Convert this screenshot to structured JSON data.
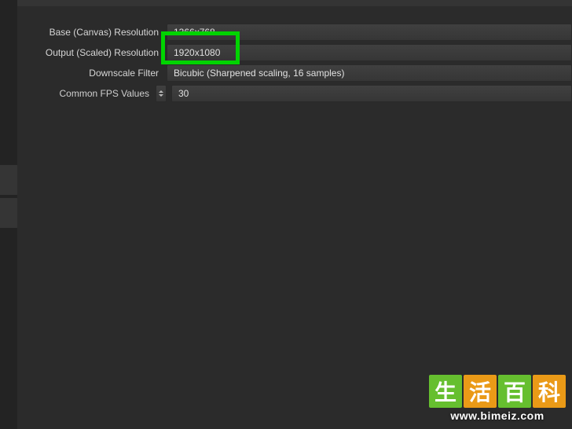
{
  "video": {
    "base_resolution_label": "Base (Canvas) Resolution",
    "base_resolution_value": "1366x768",
    "output_resolution_label": "Output (Scaled) Resolution",
    "output_resolution_value": "1920x1080",
    "downscale_filter_label": "Downscale Filter",
    "downscale_filter_value": "Bicubic (Sharpened scaling, 16 samples)",
    "fps_type_label": "Common FPS Values",
    "fps_value": "30"
  },
  "highlight": {
    "color": "#00d400"
  },
  "watermark": {
    "chars": [
      "生",
      "活",
      "百",
      "科"
    ],
    "url": "www.bimeiz.com"
  }
}
